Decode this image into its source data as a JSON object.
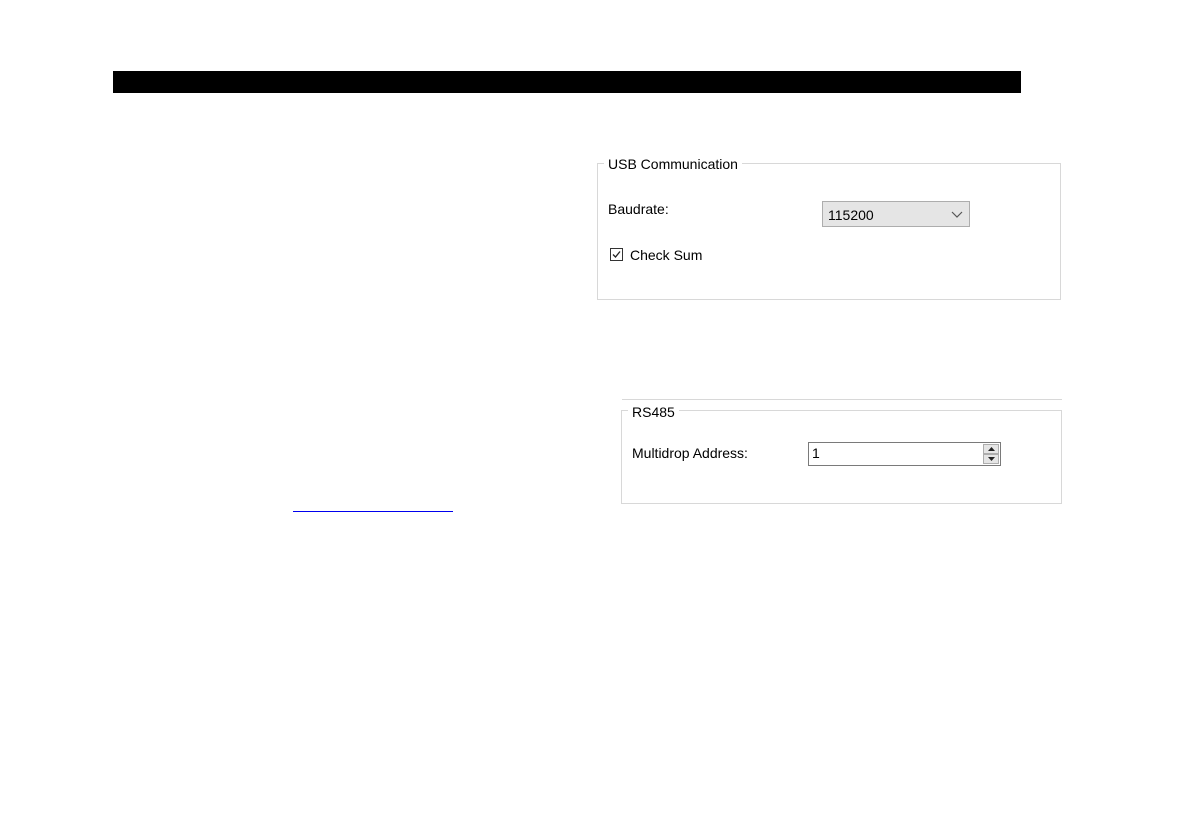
{
  "usb_group": {
    "title": "USB Communication",
    "baudrate_label": "Baudrate:",
    "baudrate_value": "115200",
    "checksum_label": "Check Sum",
    "checksum_checked": true
  },
  "rs485_group": {
    "title": "RS485",
    "address_label": "Multidrop Address:",
    "address_value": "1"
  },
  "icons": [
    "chevron-down-icon",
    "checkmark-icon",
    "spin-up-icon",
    "spin-down-icon"
  ]
}
